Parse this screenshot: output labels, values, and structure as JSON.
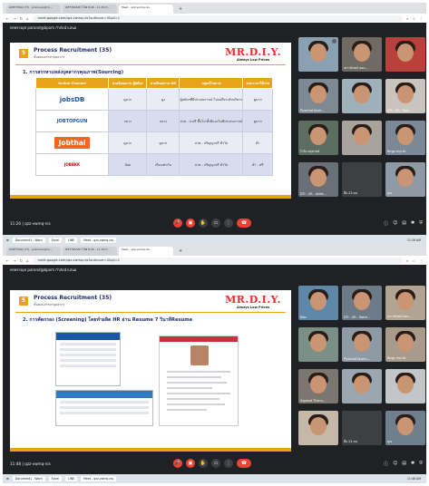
{
  "top": {
    "tabs": [
      "เอกสารของ (77) - pramuan@m...",
      "WFF BAIVR? ไทย 8.00 - 11:30 ก...",
      "Meet - qzz-vwmq-nis"
    ],
    "url": "meet.google.com/qzz-vwmq-nis?authuser=0&pli=1",
    "presenter": "พรพรรณุช parand@bpom กำลังนำเสนอ",
    "slide": {
      "num": "5",
      "title": "Process Recruitment (35)",
      "subtitle": "ขั้นตอนสรรหาบุคลากร",
      "logo": "MR.D.I.Y.",
      "logo_sub": "Always Low Prices",
      "heading": "1. การสรรหาแหล่งบุคลากรคุณภาพ(Sourcing)",
      "headers": [
        "Online Channel",
        "ค่าผลิตผลงาน ผู้สมัคร",
        "ค่าผลิตผลงาน HR",
        "กลุ่มเป้าหมาย",
        "ระยะเวลาใช้งาน"
      ],
      "rows": [
        {
          "logo": "jobsDB",
          "c1": "ดูมาก",
          "c2": "ดูง",
          "c3": "ผู้สมัครที่มีประสบการณ์ ไปจนถึงระดับบริหาร",
          "c4": "ดูมาก"
        },
        {
          "logo": "JOBTOPGUN",
          "c1": "กลาง",
          "c2": "กลาง",
          "c3": "ปวส - ป.ตรี ขึ้นไป ทั้งมีและไม่มีประสบการณ์",
          "c4": "ดูมาก"
        },
        {
          "logo": "Jobthai",
          "c1": "ดูมาก",
          "c2": "ดูมาก",
          "c3": "ปวช - ปริญญาตรี ทั่วไป",
          "c4": "ต่ำ"
        },
        {
          "logo": "JOBBKK",
          "c1": "น้อย",
          "c2": "เกือบเท่ากัน",
          "c3": "ปวช - ปริญญาตรี ทั่วไป",
          "c4": "ต่ำ - ฟรี"
        }
      ]
    },
    "participants": [
      "",
      "เสาวลักษณ์ หอม...",
      "",
      "Piyachat Nuch...",
      "",
      "DTI - UR - Ratc...",
      "ไวโบ-คฤหาสน์",
      "",
      "พิมพูล สกุล ดัง",
      "DTI - UR - Aklek...",
      "อื่น 23 คน",
      "คุณ"
    ],
    "time": "11:26",
    "meeting_code": "qzz-vwmq-nis"
  },
  "bottom": {
    "tabs": [
      "เอกสารของ (77) - pramuan@m...",
      "WFF BAIVR? ไทย 8.00 - 11:30 ก...",
      "Meet - qzz-vwmq-nis"
    ],
    "url": "meet.google.com/qzz-vwmq-nis?authuser=0&pli=1",
    "presenter": "พรพรรณุช parand@bpom กำลังนำเสนอ",
    "slide": {
      "num": "5",
      "title": "Process Recruitment (35)",
      "subtitle": "ขั้นตอนสรรหาบุคลากร",
      "logo": "MR.D.I.Y.",
      "logo_sub": "Always Low Prices",
      "heading": "2. การคัดกรอง (Screening) โดยทำผลิต HR อ่าน Resume 7 วินาทีResume"
    },
    "participants": [
      "Bibz",
      "DTI - UR - Ratch...",
      "เสาวลักษณ์ หอม...",
      "",
      "Piyachat Nuchu...",
      "พิมพูล สกุล ดัง",
      "Supasat Thanu...",
      "",
      "",
      "",
      "อื่น 24 คน",
      "คุณ"
    ],
    "time": "11:48",
    "meeting_code": "qzz-vwmq-nis",
    "taskbar": [
      "Document1 - Word",
      "Excel",
      "LINE",
      "Meet - qzz-vwmq-nis"
    ],
    "clock": "11:48 AM"
  },
  "mid_taskbar": {
    "items": [
      "Document1 - Word",
      "Excel",
      "LINE",
      "Meet - qzz-vwmq-nis"
    ],
    "clock": "11:26 AM"
  }
}
